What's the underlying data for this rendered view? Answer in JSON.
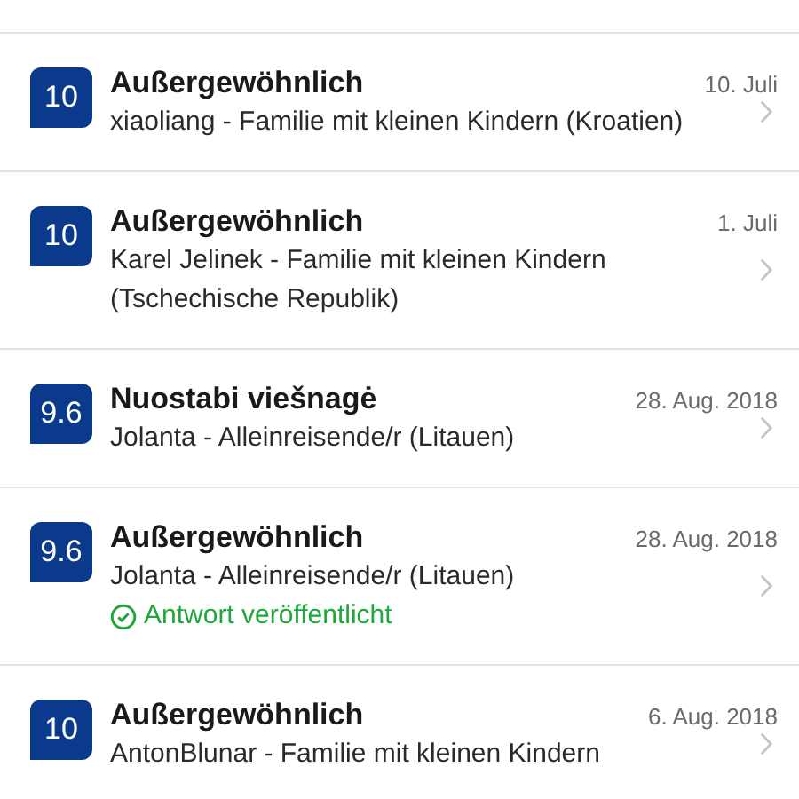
{
  "reviews": [
    {
      "score": "10",
      "title": "Außergewöhnlich",
      "date": "10. Juli",
      "author": "xiaoliang - Familie mit kleinen Kindern (Kroatien)"
    },
    {
      "score": "10",
      "title": "Außergewöhnlich",
      "date": "1. Juli",
      "author": "Karel Jelinek - Familie mit kleinen Kindern (Tschechische Republik)"
    },
    {
      "score": "9.6",
      "title": "Nuostabi viešnagė",
      "date": "28. Aug. 2018",
      "author": "Jolanta - Alleinreisende/r (Litauen)"
    },
    {
      "score": "9.6",
      "title": "Außergewöhnlich",
      "date": "28. Aug. 2018",
      "author": "Jolanta - Alleinreisende/r (Litauen)",
      "reply": "Antwort veröffentlicht"
    },
    {
      "score": "10",
      "title": "Außergewöhnlich",
      "date": "6. Aug. 2018",
      "author": "AntonBlunar - Familie mit kleinen Kindern"
    }
  ]
}
